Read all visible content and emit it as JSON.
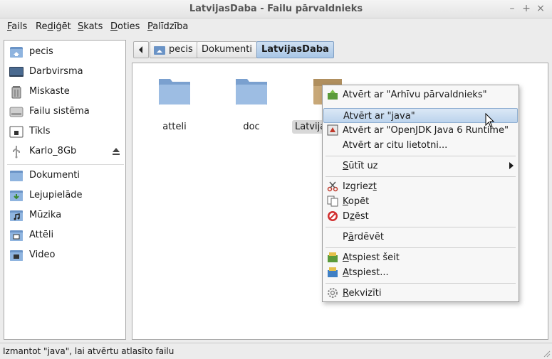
{
  "window": {
    "title": "LatvijasDaba - Failu pārvaldnieks"
  },
  "menubar": {
    "items": [
      {
        "u": "F",
        "rest": "ails"
      },
      {
        "pre": "Re",
        "u": "d",
        "rest": "iģēt"
      },
      {
        "u": "S",
        "rest": "kats"
      },
      {
        "u": "D",
        "rest": "oties"
      },
      {
        "u": "P",
        "rest": "alīdzība"
      }
    ]
  },
  "sidebar": {
    "places": [
      {
        "label": "pecis",
        "icon": "home-folder-icon"
      },
      {
        "label": "Darbvirsma",
        "icon": "desktop-icon"
      },
      {
        "label": "Miskaste",
        "icon": "trash-icon"
      },
      {
        "label": "Failu sistēma",
        "icon": "harddisk-icon"
      },
      {
        "label": "Tīkls",
        "icon": "network-folder-icon"
      },
      {
        "label": "Karlo_8Gb",
        "icon": "usb-drive-icon"
      }
    ],
    "bookmarks": [
      {
        "label": "Dokumenti",
        "icon": "documents-folder-icon"
      },
      {
        "label": "Lejupielāde",
        "icon": "downloads-folder-icon"
      },
      {
        "label": "Mūzika",
        "icon": "music-folder-icon"
      },
      {
        "label": "Attēli",
        "icon": "pictures-folder-icon"
      },
      {
        "label": "Video",
        "icon": "video-folder-icon"
      }
    ]
  },
  "pathbar": {
    "segments": [
      "pecis",
      "Dokumenti",
      "LatvijasDaba"
    ]
  },
  "files": [
    {
      "name": "atteli",
      "type": "folder"
    },
    {
      "name": "doc",
      "type": "folder"
    },
    {
      "name": "Latvija",
      "type": "archive"
    }
  ],
  "context_menu": {
    "open_archive": "Atvērt ar \"Arhīvu pārvaldnieks\"",
    "open_java": "Atvērt ar \"java\"",
    "open_openjdk": "Atvērt ar \"OpenJDK Java 6 Runtime\"",
    "open_other": "Atvērt ar citu lietotni...",
    "send_to": {
      "u": "S",
      "rest": "ūtīt uz"
    },
    "cut": {
      "pre": "Izgriez",
      "u": "t",
      "rest": ""
    },
    "copy": {
      "pre": "",
      "u": "K",
      "rest": "opēt"
    },
    "delete": {
      "pre": "D",
      "u": "z",
      "rest": "ēst"
    },
    "rename": {
      "pre": "P",
      "u": "ā",
      "rest": "rdēvēt"
    },
    "extract_here": {
      "pre": "",
      "u": "A",
      "rest": "tspiest šeit"
    },
    "extract": {
      "pre": "",
      "u": "A",
      "rest": "tspiest..."
    },
    "properties": {
      "pre": "",
      "u": "R",
      "rest": "ekvizīti"
    }
  },
  "statusbar": {
    "text": "Izmantot \"java\", lai atvērtu atlasīto failu"
  }
}
